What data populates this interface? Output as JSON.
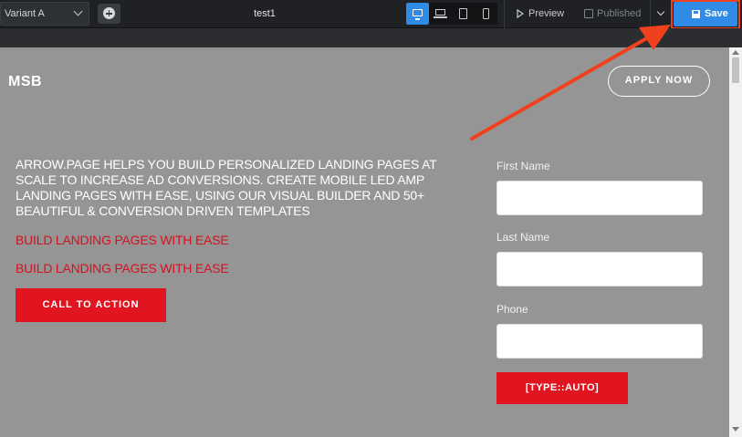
{
  "toolbar": {
    "variant": "Variant A",
    "title": "test1",
    "preview_label": "Preview",
    "published_label": "Published",
    "save_label": "Save",
    "active_device": "desktop",
    "accent_color": "#2f8be6"
  },
  "page": {
    "logo": "MSB",
    "apply_label": "APPLY NOW",
    "headline": "ARROW.PAGE HELPS YOU BUILD PERSONALIZED LANDING PAGES AT SCALE TO INCREASE AD CONVERSIONS. CREATE MOBILE LED AMP LANDING PAGES WITH EASE, USING OUR VISUAL BUILDER AND 50+ BEAUTIFUL & CONVERSION DRIVEN TEMPLATES",
    "sub1": "BUILD LANDING PAGES WITH EASE",
    "sub2": "BUILD LANDING PAGES WITH EASE",
    "cta_label": "CALL TO ACTION",
    "brand_color": "#e1151f",
    "form": {
      "first_name_label": "First Name",
      "last_name_label": "Last Name",
      "phone_label": "Phone",
      "submit_label": "[TYPE::AUTO]"
    }
  },
  "annotation": {
    "arrow_color": "#f0411e"
  }
}
